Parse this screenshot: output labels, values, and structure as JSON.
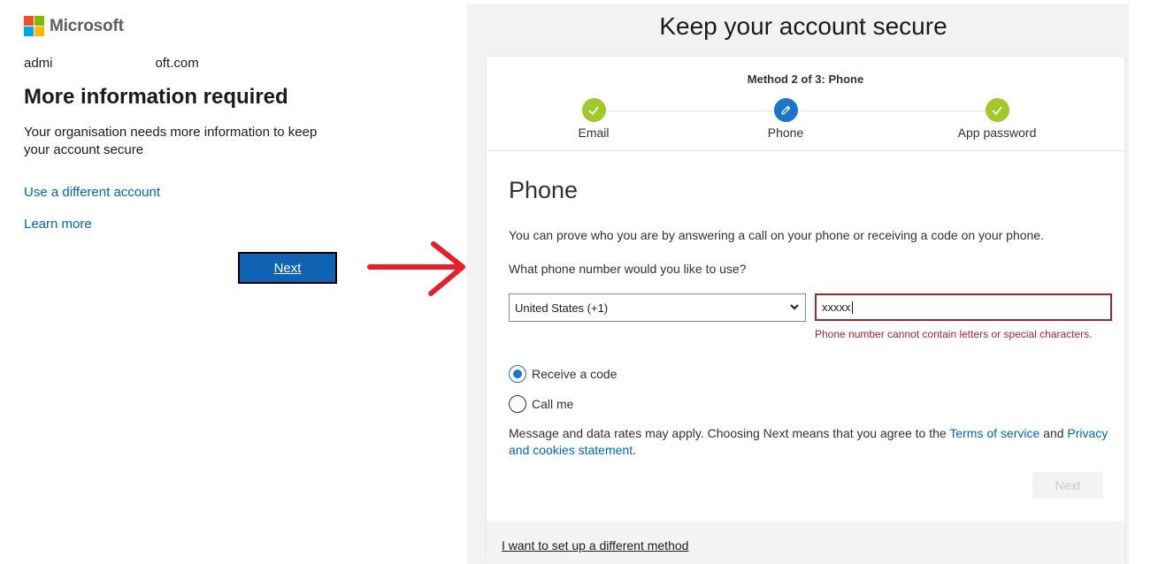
{
  "left": {
    "brand": "Microsoft",
    "email_prefix": "admi",
    "email_suffix": "oft.com",
    "heading": "More information required",
    "description": "Your organisation needs more information to keep your account secure",
    "link_different_account": "Use a different account",
    "link_learn_more": "Learn more",
    "next_label": "Next"
  },
  "right": {
    "title": "Keep your account secure",
    "method_progress": "Method 2 of 3: Phone",
    "steps": [
      {
        "label": "Email",
        "state": "done"
      },
      {
        "label": "Phone",
        "state": "current"
      },
      {
        "label": "App password",
        "state": "done"
      }
    ],
    "section_heading": "Phone",
    "prove_text": "You can prove who you are by answering a call on your phone or receiving a code on your phone.",
    "question": "What phone number would you like to use?",
    "country_value": "United States (+1)",
    "phone_value": "xxxxx",
    "error_text": "Phone number cannot contain letters or special characters.",
    "radio_receive_code": "Receive a code",
    "radio_call_me": "Call me",
    "selected_option": "Receive a code",
    "terms_prefix": "Message and data rates may apply. Choosing Next means that you agree to the",
    "terms_link": "Terms of service",
    "terms_and": "and",
    "privacy_link": "Privacy and cookies statement",
    "terms_end": ".",
    "next_label": "Next",
    "different_method": "I want to set up a different method"
  },
  "colors": {
    "ms_red": "#f25022",
    "ms_green": "#7fba00",
    "ms_blue": "#00a4ef",
    "ms_yellow": "#ffb900",
    "link": "#0067b8",
    "primary_button": "#0f63b2",
    "error": "#a4262c",
    "step_done": "#a1c92e",
    "step_current": "#1e74c7",
    "arrow": "#e5202a"
  },
  "icons": {
    "step_done": "check-icon",
    "step_current": "pencil-icon",
    "country_dropdown": "chevron-down-icon",
    "annotation": "right-arrow-icon"
  }
}
